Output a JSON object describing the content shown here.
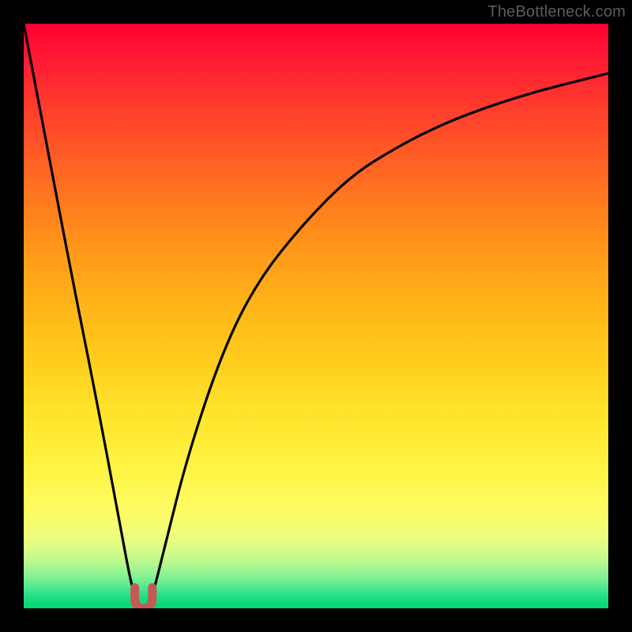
{
  "watermark": "TheBottleneck.com",
  "chart_data": {
    "type": "line",
    "title": "",
    "xlabel": "",
    "ylabel": "",
    "xlim": [
      0,
      100
    ],
    "ylim": [
      0,
      100
    ],
    "grid": false,
    "series": [
      {
        "name": "bottleneck-curve",
        "x": [
          0,
          4,
          8,
          12,
          16,
          18,
          19,
          20,
          21,
          22,
          24,
          28,
          34,
          40,
          48,
          56,
          64,
          72,
          80,
          88,
          96,
          100
        ],
        "y": [
          100,
          79,
          58,
          38,
          17,
          6,
          2,
          0,
          0,
          2,
          10,
          26,
          44,
          56,
          66,
          74,
          79,
          83,
          86,
          88.5,
          90.5,
          91.5
        ]
      }
    ],
    "marker": {
      "name": "optimal-point",
      "x_range": [
        19,
        22
      ],
      "y_range": [
        0,
        3
      ]
    },
    "background_gradient": {
      "top": "#ff0033",
      "mid": "#ffea33",
      "bottom": "#00d774"
    }
  }
}
